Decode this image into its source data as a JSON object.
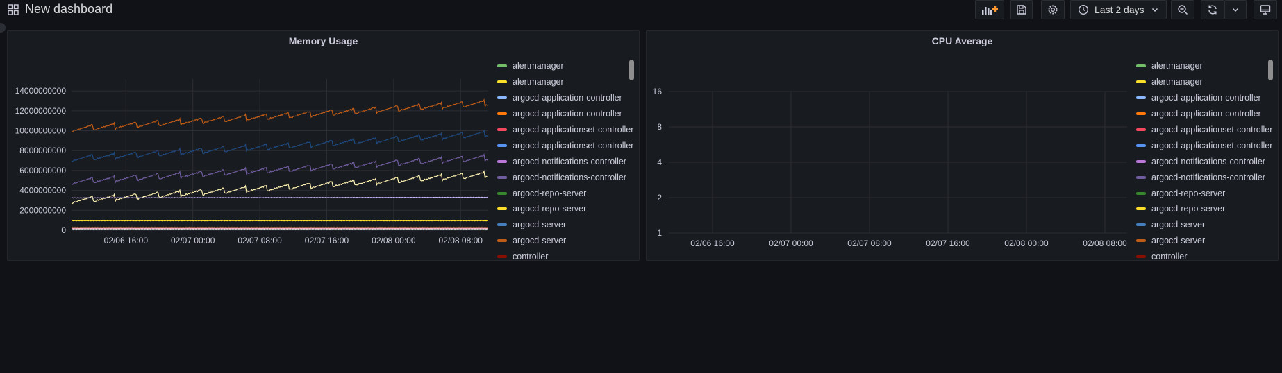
{
  "dashboard": {
    "title": "New dashboard"
  },
  "toolbar": {
    "time_range_label": "Last 2 days"
  },
  "icons": [
    "dashboard-grid-icon",
    "add-panel-icon",
    "save-icon",
    "settings-icon",
    "clock-icon",
    "chevron-down-icon",
    "zoom-out-icon",
    "refresh-icon",
    "tv-mode-icon"
  ],
  "colors": {
    "background": "#111217",
    "panel": "#181b1f",
    "grid": "#2c2e35",
    "text": "#ccccdc",
    "accent_orange": "#ff9830"
  },
  "legend_items": [
    {
      "label": "alertmanager",
      "color": "#73bf69"
    },
    {
      "label": "alertmanager",
      "color": "#fade2a"
    },
    {
      "label": "argocd-application-controller",
      "color": "#8ab8ff"
    },
    {
      "label": "argocd-application-controller",
      "color": "#ff780a"
    },
    {
      "label": "argocd-applicationset-controller",
      "color": "#f2495c"
    },
    {
      "label": "argocd-applicationset-controller",
      "color": "#5794f2"
    },
    {
      "label": "argocd-notifications-controller",
      "color": "#b877d9"
    },
    {
      "label": "argocd-notifications-controller",
      "color": "#705da0"
    },
    {
      "label": "argocd-repo-server",
      "color": "#37872d"
    },
    {
      "label": "argocd-repo-server",
      "color": "#fade2a"
    },
    {
      "label": "argocd-server",
      "color": "#447ebc"
    },
    {
      "label": "argocd-server",
      "color": "#c15c17"
    },
    {
      "label": "controller",
      "color": "#890f02"
    }
  ],
  "chart_data": [
    {
      "type": "line",
      "title": "Memory Usage",
      "x_ticks": [
        "02/06 16:00",
        "02/07 00:00",
        "02/07 08:00",
        "02/07 16:00",
        "02/08 00:00",
        "02/08 08:00"
      ],
      "y_ticks": [
        "0",
        "2000000000",
        "4000000000",
        "6000000000",
        "8000000000",
        "10000000000",
        "12000000000",
        "14000000000"
      ],
      "ylim": [
        0,
        14500000000
      ],
      "x_range_hours": [
        -6.5,
        43.3
      ],
      "series": [
        {
          "color": "#c15c17",
          "start": 10200000000,
          "end": 12800000000,
          "saw": true
        },
        {
          "color": "#1f4a80",
          "start": 7200000000,
          "end": 9700000000,
          "saw": true
        },
        {
          "color": "#705da0",
          "start": 4900000000,
          "end": 7300000000,
          "saw": true
        },
        {
          "color": "#fff2b2",
          "start": 3000000000,
          "end": 5600000000,
          "saw": true
        },
        {
          "color": "#c9b8ff",
          "start": 3250000000,
          "end": 3300000000,
          "saw": false
        },
        {
          "color": "#fade2a",
          "start": 950000000,
          "end": 950000000,
          "saw": false
        },
        {
          "color": "#e0752d",
          "start": 300000000,
          "end": 300000000,
          "saw": false
        },
        {
          "color": "#ffb3c8",
          "start": 180000000,
          "end": 180000000,
          "saw": false
        },
        {
          "color": "#d8d9da",
          "start": 60000000,
          "end": 60000000,
          "saw": false
        }
      ]
    },
    {
      "type": "line",
      "title": "CPU Average",
      "log_scale": true,
      "x_ticks": [
        "02/06 16:00",
        "02/07 00:00",
        "02/07 08:00",
        "02/07 16:00",
        "02/08 00:00",
        "02/08 08:00"
      ],
      "y_ticks": [
        "1",
        "2",
        "4",
        "8",
        "16"
      ],
      "x_range_hours": [
        -6.5,
        43.3
      ],
      "series": []
    }
  ]
}
